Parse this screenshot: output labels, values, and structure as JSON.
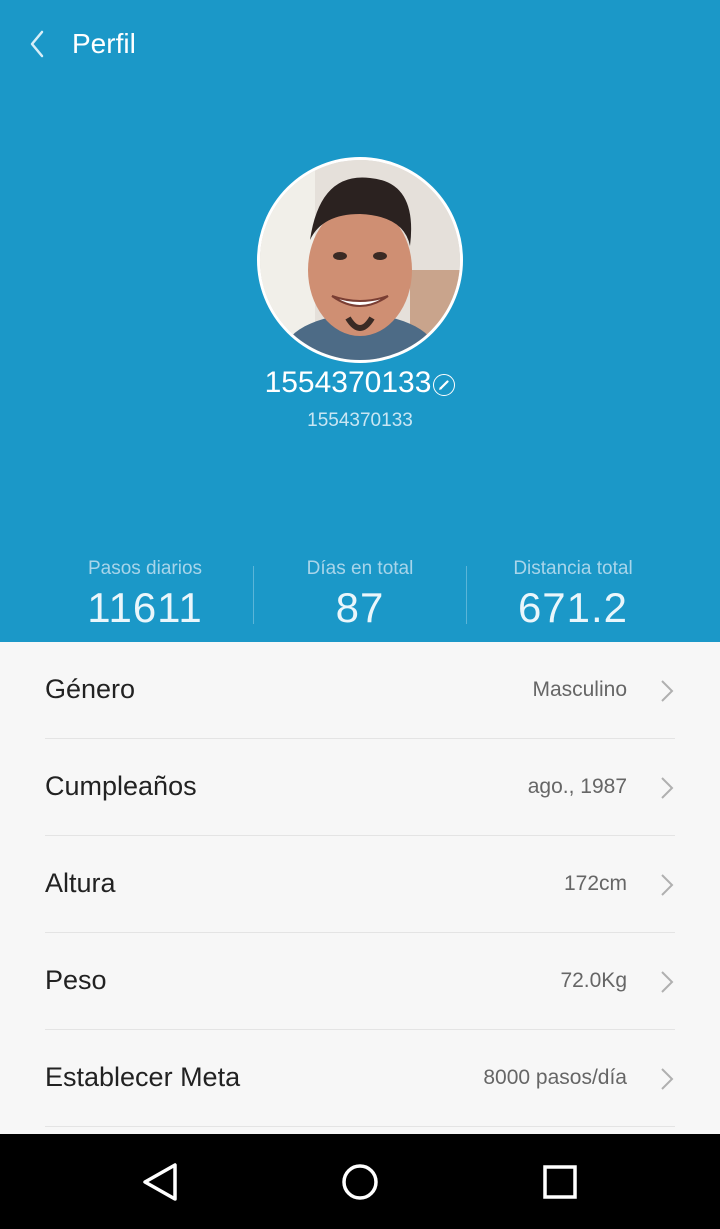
{
  "header": {
    "title": "Perfil"
  },
  "profile": {
    "name": "1554370133",
    "id": "1554370133"
  },
  "stats": [
    {
      "label": "Pasos diarios",
      "value": "11611"
    },
    {
      "label": "Días en total",
      "value": "87"
    },
    {
      "label": "Distancia total",
      "value": "671.2"
    }
  ],
  "settings": [
    {
      "label": "Género",
      "value": "Masculino"
    },
    {
      "label": "Cumpleaños",
      "value": "ago., 1987"
    },
    {
      "label": "Altura",
      "value": "172cm"
    },
    {
      "label": "Peso",
      "value": "72.0Kg"
    },
    {
      "label": "Establecer Meta",
      "value": "8000 pasos/día"
    }
  ],
  "colors": {
    "header_bg": "#1b98c8",
    "list_bg": "#f7f7f7",
    "navbar_bg": "#000000"
  },
  "icons": [
    "back-arrow-icon",
    "edit-pencil-icon",
    "chevron-right-icon",
    "nav-back-icon",
    "nav-home-icon",
    "nav-recents-icon"
  ]
}
